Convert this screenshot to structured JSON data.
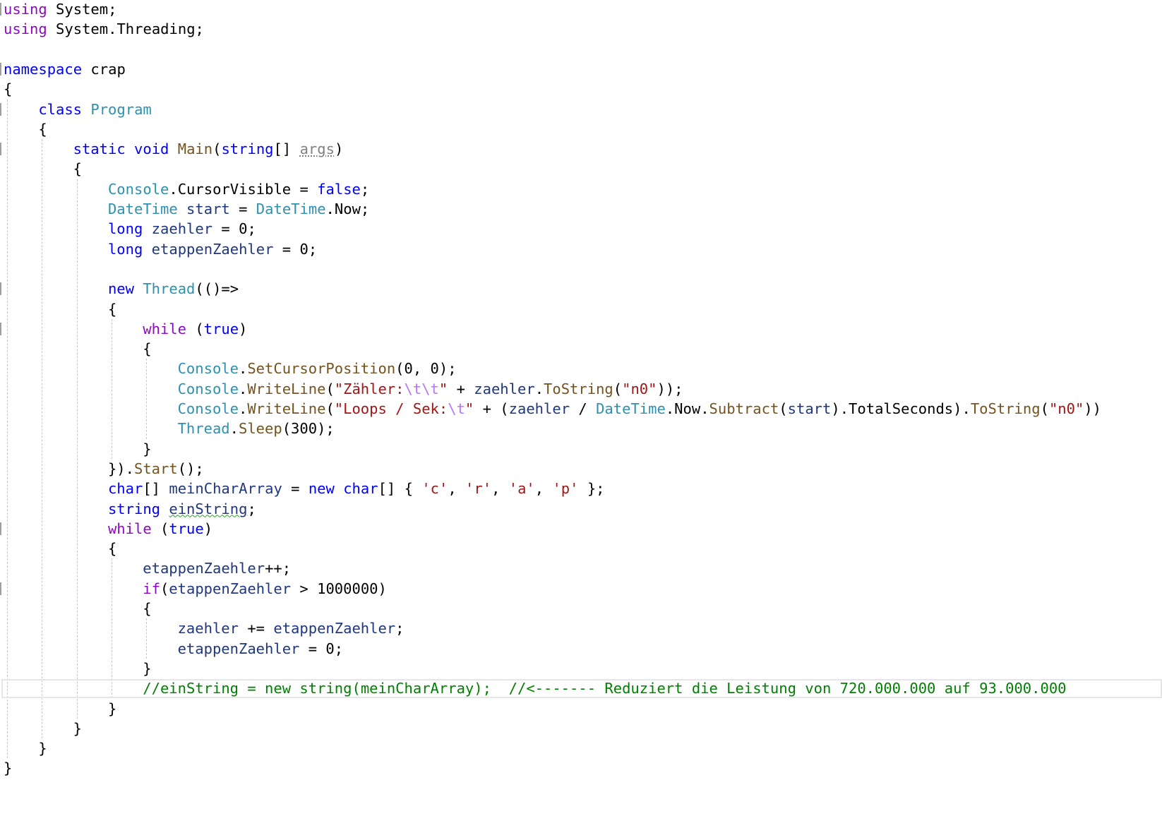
{
  "editor": {
    "colors": {
      "keyword": "#0000ff",
      "type": "#2b91af",
      "method": "#74531f",
      "variable": "#1f377f",
      "string": "#a31515",
      "escape": "#b776fb",
      "comment": "#008000",
      "control": "#8f08c4"
    },
    "highlighted_line": 34,
    "lines": [
      {
        "i": 0,
        "t": [
          [
            "f",
            "using"
          ],
          [
            "p",
            " System;"
          ]
        ]
      },
      {
        "i": 0,
        "t": [
          [
            "f",
            "using"
          ],
          [
            "p",
            " System.Threading;"
          ]
        ]
      },
      {
        "i": 0,
        "t": []
      },
      {
        "i": 0,
        "t": [
          [
            "k",
            "namespace"
          ],
          [
            "p",
            " crap"
          ]
        ]
      },
      {
        "i": 0,
        "t": [
          [
            "p",
            "{"
          ]
        ]
      },
      {
        "i": 1,
        "t": [
          [
            "k",
            "class"
          ],
          [
            "p",
            " "
          ],
          [
            "t",
            "Program"
          ]
        ]
      },
      {
        "i": 1,
        "t": [
          [
            "p",
            "{"
          ]
        ]
      },
      {
        "i": 2,
        "t": [
          [
            "k",
            "static"
          ],
          [
            "p",
            " "
          ],
          [
            "k",
            "void"
          ],
          [
            "p",
            " "
          ],
          [
            "m",
            "Main"
          ],
          [
            "p",
            "("
          ],
          [
            "k",
            "string"
          ],
          [
            "p",
            "[] "
          ],
          [
            "g",
            "args"
          ],
          [
            "p",
            ")"
          ]
        ]
      },
      {
        "i": 2,
        "t": [
          [
            "p",
            "{"
          ]
        ]
      },
      {
        "i": 3,
        "t": [
          [
            "t",
            "Console"
          ],
          [
            "p",
            ".CursorVisible = "
          ],
          [
            "k",
            "false"
          ],
          [
            "p",
            ";"
          ]
        ]
      },
      {
        "i": 3,
        "t": [
          [
            "t",
            "DateTime"
          ],
          [
            "p",
            " "
          ],
          [
            "v",
            "start"
          ],
          [
            "p",
            " = "
          ],
          [
            "t",
            "DateTime"
          ],
          [
            "p",
            ".Now;"
          ]
        ]
      },
      {
        "i": 3,
        "t": [
          [
            "k",
            "long"
          ],
          [
            "p",
            " "
          ],
          [
            "v",
            "zaehler"
          ],
          [
            "p",
            " = 0;"
          ]
        ]
      },
      {
        "i": 3,
        "t": [
          [
            "k",
            "long"
          ],
          [
            "p",
            " "
          ],
          [
            "v",
            "etappenZaehler"
          ],
          [
            "p",
            " = 0;"
          ]
        ]
      },
      {
        "i": 0,
        "t": []
      },
      {
        "i": 3,
        "t": [
          [
            "k",
            "new"
          ],
          [
            "p",
            " "
          ],
          [
            "t",
            "Thread"
          ],
          [
            "p",
            "(()=>"
          ]
        ]
      },
      {
        "i": 3,
        "t": [
          [
            "p",
            "{"
          ]
        ]
      },
      {
        "i": 4,
        "t": [
          [
            "f",
            "while"
          ],
          [
            "p",
            " ("
          ],
          [
            "k",
            "true"
          ],
          [
            "p",
            ")"
          ]
        ]
      },
      {
        "i": 4,
        "t": [
          [
            "p",
            "{"
          ]
        ]
      },
      {
        "i": 5,
        "t": [
          [
            "t",
            "Console"
          ],
          [
            "p",
            "."
          ],
          [
            "m",
            "SetCursorPosition"
          ],
          [
            "p",
            "(0, 0);"
          ]
        ]
      },
      {
        "i": 5,
        "t": [
          [
            "t",
            "Console"
          ],
          [
            "p",
            "."
          ],
          [
            "m",
            "WriteLine"
          ],
          [
            "p",
            "("
          ],
          [
            "s",
            "\"Zähler:"
          ],
          [
            "e",
            "\\t\\t"
          ],
          [
            "s",
            "\""
          ],
          [
            "p",
            " + "
          ],
          [
            "v",
            "zaehler"
          ],
          [
            "p",
            "."
          ],
          [
            "m",
            "ToString"
          ],
          [
            "p",
            "("
          ],
          [
            "s",
            "\"n0\""
          ],
          [
            "p",
            "));"
          ]
        ]
      },
      {
        "i": 5,
        "t": [
          [
            "t",
            "Console"
          ],
          [
            "p",
            "."
          ],
          [
            "m",
            "WriteLine"
          ],
          [
            "p",
            "("
          ],
          [
            "s",
            "\"Loops / Sek:"
          ],
          [
            "e",
            "\\t"
          ],
          [
            "s",
            "\""
          ],
          [
            "p",
            " + ("
          ],
          [
            "v",
            "zaehler"
          ],
          [
            "p",
            " / "
          ],
          [
            "t",
            "DateTime"
          ],
          [
            "p",
            ".Now."
          ],
          [
            "m",
            "Subtract"
          ],
          [
            "p",
            "("
          ],
          [
            "v",
            "start"
          ],
          [
            "p",
            ").TotalSeconds)."
          ],
          [
            "m",
            "ToString"
          ],
          [
            "p",
            "("
          ],
          [
            "s",
            "\"n0\""
          ],
          [
            "p",
            "))"
          ]
        ]
      },
      {
        "i": 5,
        "t": [
          [
            "t",
            "Thread"
          ],
          [
            "p",
            "."
          ],
          [
            "m",
            "Sleep"
          ],
          [
            "p",
            "(300);"
          ]
        ]
      },
      {
        "i": 4,
        "t": [
          [
            "p",
            "}"
          ]
        ]
      },
      {
        "i": 3,
        "t": [
          [
            "p",
            "})."
          ],
          [
            "m",
            "Start"
          ],
          [
            "p",
            "();"
          ]
        ]
      },
      {
        "i": 3,
        "t": [
          [
            "k",
            "char"
          ],
          [
            "p",
            "[] "
          ],
          [
            "v",
            "meinCharArray"
          ],
          [
            "p",
            " = "
          ],
          [
            "k",
            "new"
          ],
          [
            "p",
            " "
          ],
          [
            "k",
            "char"
          ],
          [
            "p",
            "[] { "
          ],
          [
            "s",
            "'c'"
          ],
          [
            "p",
            ", "
          ],
          [
            "s",
            "'r'"
          ],
          [
            "p",
            ", "
          ],
          [
            "s",
            "'a'"
          ],
          [
            "p",
            ", "
          ],
          [
            "s",
            "'p'"
          ],
          [
            "p",
            " };"
          ]
        ]
      },
      {
        "i": 3,
        "t": [
          [
            "k",
            "string"
          ],
          [
            "p",
            " "
          ],
          [
            "w",
            "einString"
          ],
          [
            "p",
            ";"
          ]
        ]
      },
      {
        "i": 3,
        "t": [
          [
            "f",
            "while"
          ],
          [
            "p",
            " ("
          ],
          [
            "k",
            "true"
          ],
          [
            "p",
            ")"
          ]
        ]
      },
      {
        "i": 3,
        "t": [
          [
            "p",
            "{"
          ]
        ]
      },
      {
        "i": 4,
        "t": [
          [
            "v",
            "etappenZaehler"
          ],
          [
            "p",
            "++;"
          ]
        ]
      },
      {
        "i": 4,
        "t": [
          [
            "f",
            "if"
          ],
          [
            "p",
            "("
          ],
          [
            "v",
            "etappenZaehler"
          ],
          [
            "p",
            " > 1000000)"
          ]
        ]
      },
      {
        "i": 4,
        "t": [
          [
            "p",
            "{"
          ]
        ]
      },
      {
        "i": 5,
        "t": [
          [
            "v",
            "zaehler"
          ],
          [
            "p",
            " += "
          ],
          [
            "v",
            "etappenZaehler"
          ],
          [
            "p",
            ";"
          ]
        ]
      },
      {
        "i": 5,
        "t": [
          [
            "v",
            "etappenZaehler"
          ],
          [
            "p",
            " = 0;"
          ]
        ]
      },
      {
        "i": 4,
        "t": [
          [
            "p",
            "}"
          ]
        ]
      },
      {
        "i": 4,
        "t": [
          [
            "c",
            "//einString = new string(meinCharArray);  //<------- Reduziert die Leistung von 720.000.000 auf 93.000.000"
          ]
        ]
      },
      {
        "i": 3,
        "t": [
          [
            "p",
            "}"
          ]
        ]
      },
      {
        "i": 2,
        "t": [
          [
            "p",
            "}"
          ]
        ]
      },
      {
        "i": 1,
        "t": [
          [
            "p",
            "}"
          ]
        ]
      },
      {
        "i": 0,
        "t": [
          [
            "p",
            "}"
          ]
        ]
      }
    ]
  }
}
